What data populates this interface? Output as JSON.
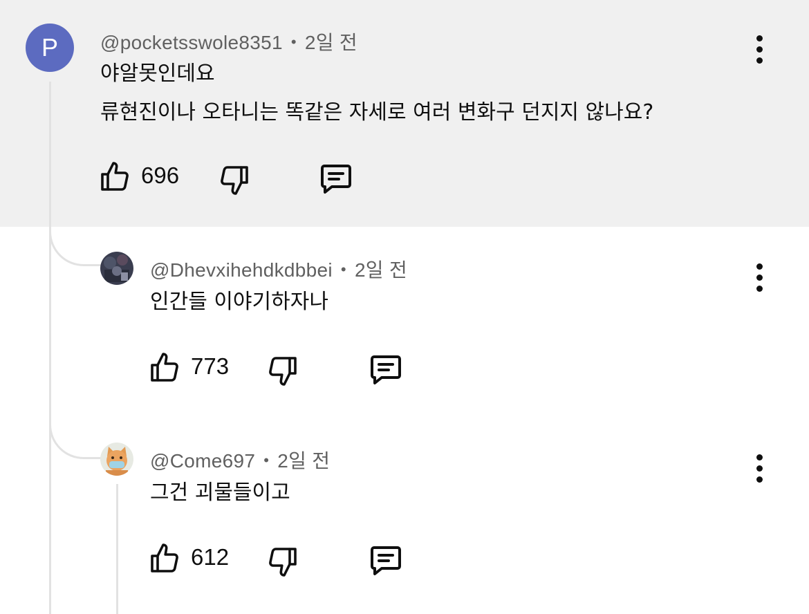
{
  "comments": [
    {
      "author": "@pocketsswole8351",
      "avatar_letter": "P",
      "time": "2일 전",
      "text_lines": [
        "야알못인데요",
        "류현진이나 오타니는 똑같은 자세로 여러 변화구 던지지 않나요?"
      ],
      "likes": "696"
    },
    {
      "author": "@Dhevxihehdkdbbei",
      "time": "2일 전",
      "text_lines": [
        "인간들 이야기하자나"
      ],
      "likes": "773"
    },
    {
      "author": "@Come697",
      "time": "2일 전",
      "text_lines": [
        "그건 괴물들이고"
      ],
      "likes": "612"
    }
  ],
  "separator": "•",
  "icons": {
    "like": "thumbs-up-icon",
    "dislike": "thumbs-down-icon",
    "reply": "reply-comment-icon",
    "menu": "more-vertical-icon"
  },
  "colors": {
    "highlight_background": "#f0f0f0",
    "avatar_letter_background": "#5c6bc0",
    "meta_text": "#606060",
    "thread_line": "#e2e2e2"
  }
}
